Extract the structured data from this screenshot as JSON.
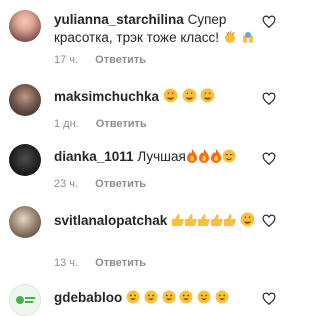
{
  "comments": [
    {
      "username": "yulianna_starchilina",
      "text": "Супер красотка, трэк тоже класс!",
      "emoji_after": [
        "clapping-hand",
        "raising-hands"
      ],
      "time": "17 ч.",
      "reply_label": "Ответить"
    },
    {
      "username": "maksimchuchka",
      "text": "",
      "emoji_after": [
        "heart-eyes",
        "heart-eyes",
        "heart-eyes"
      ],
      "time": "1 дн.",
      "reply_label": "Ответить"
    },
    {
      "username": "dianka_1011",
      "text": "Лучшая",
      "emoji_after": [
        "fire",
        "fire",
        "fire",
        "relieved-face"
      ],
      "time": "23 ч.",
      "reply_label": "Ответить"
    },
    {
      "username": "svitlanalopatchak",
      "text": "",
      "emoji_after": [
        "thumbs-up",
        "thumbs-up",
        "thumbs-up",
        "thumbs-up",
        "thumbs-up",
        "heart-eyes"
      ],
      "time": "13 ч.",
      "reply_label": "Ответить"
    },
    {
      "username": "gdebabloo",
      "text": "",
      "emoji_after": [
        "grinning-face",
        "grinning-face",
        "grinning-face",
        "grinning-face",
        "grinning-face",
        "grinning-face"
      ],
      "time": "",
      "reply_label": ""
    }
  ],
  "colors": {
    "text": "#262626",
    "meta": "#8e8e8e",
    "emoji_yellow": "#f7c23a",
    "heart_red": "#e0283b",
    "fire": "#f46c1b"
  },
  "icons": {
    "like": "heart-outline-icon"
  }
}
